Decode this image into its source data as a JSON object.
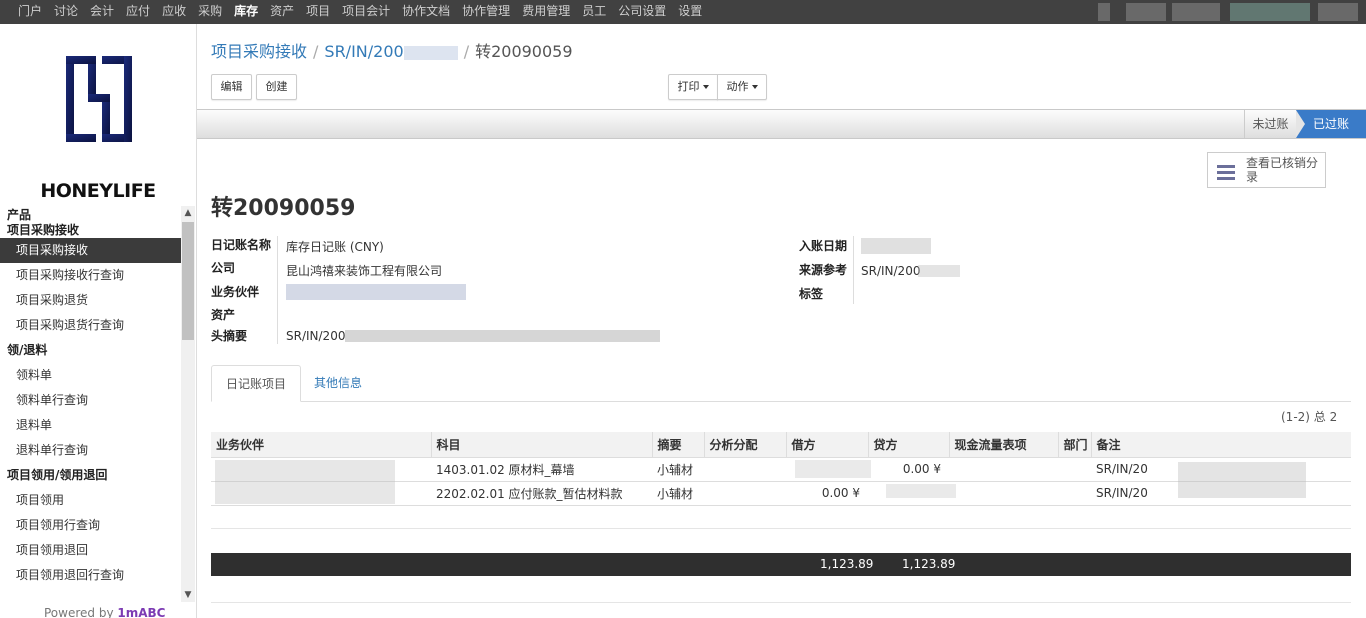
{
  "nav": {
    "items": [
      "门户",
      "讨论",
      "会计",
      "应付",
      "应收",
      "采购",
      "库存",
      "资产",
      "项目",
      "项目会计",
      "协作文档",
      "协作管理",
      "费用管理",
      "员工",
      "公司设置",
      "设置"
    ],
    "active_index": 6
  },
  "logo": {
    "text": "HONEYLIFE"
  },
  "sidebar": {
    "sections": [
      {
        "heading": "产品",
        "items": []
      },
      {
        "heading": "项目采购接收",
        "items": [
          "项目采购接收",
          "项目采购接收行查询",
          "项目采购退货",
          "项目采购退货行查询"
        ]
      },
      {
        "heading": "领/退料",
        "items": [
          "领料单",
          "领料单行查询",
          "退料单",
          "退料单行查询"
        ]
      },
      {
        "heading": "项目领用/领用退回",
        "items": [
          "项目领用",
          "项目领用行查询",
          "项目领用退回",
          "项目领用退回行查询"
        ]
      }
    ],
    "active_item": "项目采购接收",
    "powered_prefix": "Powered by ",
    "powered_brand": "1mABC"
  },
  "breadcrumb": {
    "root": "项目采购接收",
    "middle": "SR/IN/200",
    "current": "转20090059"
  },
  "toolbar": {
    "edit": "编辑",
    "create": "创建",
    "print": "打印",
    "action": "动作"
  },
  "status": {
    "draft": "未过账",
    "posted": "已过账",
    "current": "已过账"
  },
  "smart_button": {
    "label": "查看已核销分录"
  },
  "record": {
    "title": "转20090059",
    "fields_left": [
      {
        "label": "日记账名称",
        "value": "库存日记账 (CNY)"
      },
      {
        "label": "公司",
        "value": "昆山鸿禧来装饰工程有限公司"
      },
      {
        "label": "业务伙伴",
        "value": ""
      },
      {
        "label": "资产",
        "value": ""
      },
      {
        "label": "头摘要",
        "value": "SR/IN/200"
      }
    ],
    "fields_right": [
      {
        "label": "入账日期",
        "value": ""
      },
      {
        "label": "来源参考",
        "value": "SR/IN/200"
      },
      {
        "label": "标签",
        "value": ""
      }
    ]
  },
  "tabs": {
    "lines": "日记账项目",
    "other": "其他信息"
  },
  "pager": "(1-2) 总 2",
  "lines": {
    "columns": [
      "业务伙伴",
      "科目",
      "摘要",
      "分析分配",
      "借方",
      "贷方",
      "现金流量表项",
      "部门",
      "备注"
    ],
    "rows": [
      {
        "partner": "",
        "account": "1403.01.02 原材料_幕墙",
        "memo": "小辅材",
        "analytic": "",
        "debit": "",
        "credit": "0.00 ¥",
        "cashflow": "",
        "dept": "",
        "note": "SR/IN/20"
      },
      {
        "partner": "",
        "account": "2202.02.01 应付账款_暂估材料款",
        "memo": "小辅材",
        "analytic": "",
        "debit": "0.00 ¥",
        "credit": "",
        "cashflow": "",
        "dept": "",
        "note": "SR/IN/20"
      }
    ],
    "total_debit": "1,123.89",
    "total_credit": "1,123.89"
  }
}
